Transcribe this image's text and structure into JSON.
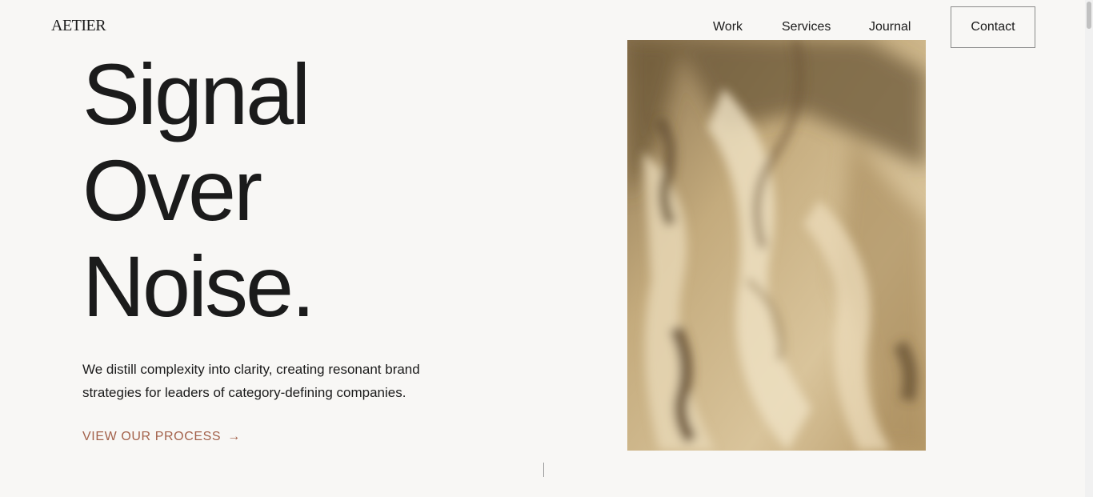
{
  "brand": {
    "logo": "AETIER"
  },
  "nav": {
    "items": [
      {
        "label": "Work"
      },
      {
        "label": "Services"
      },
      {
        "label": "Journal"
      }
    ],
    "contact_label": "Contact"
  },
  "hero": {
    "headline": [
      "Signal",
      "Over",
      "Noise."
    ],
    "lede": "We distill complexity into clarity, creating resonant brand strategies for leaders of category-defining companies.",
    "cta_label": "VIEW OUR PROCESS",
    "cta_arrow": "→"
  },
  "colors": {
    "background": "#f8f7f5",
    "text": "#1b1b1b",
    "accent": "#a3614a"
  }
}
